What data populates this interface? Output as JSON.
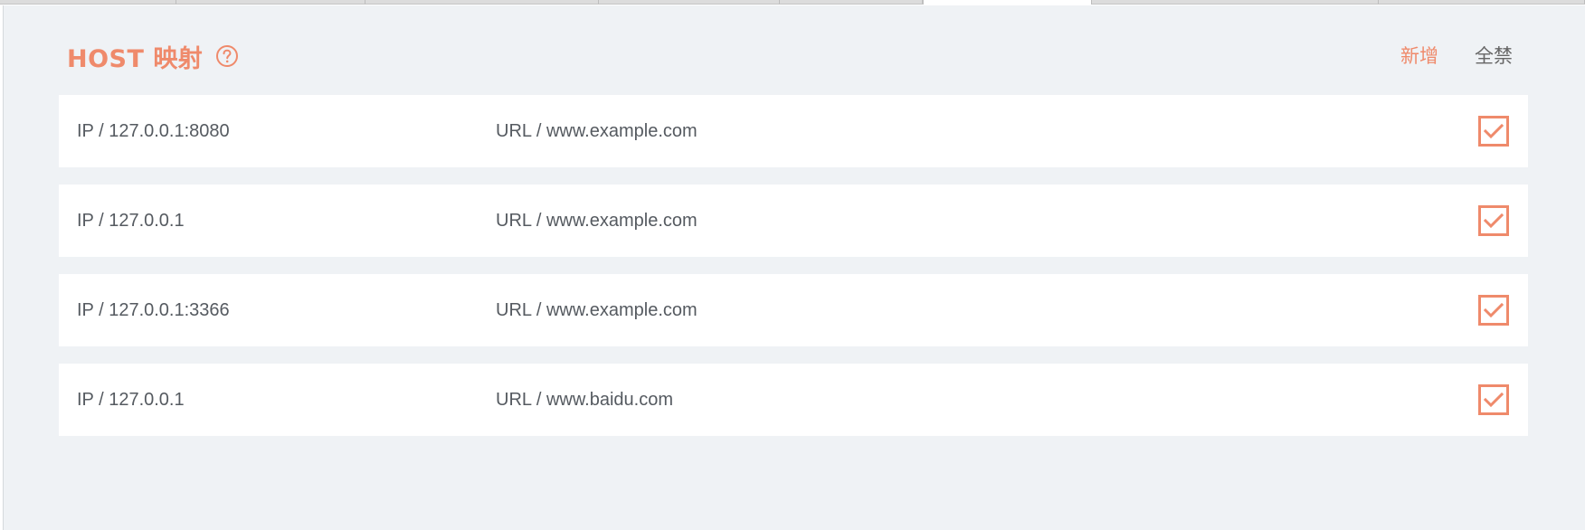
{
  "header": {
    "title": "HOST 映射",
    "help_icon": "question-circle-icon"
  },
  "actions": {
    "add_label": "新增",
    "disable_all_label": "全禁"
  },
  "colors": {
    "accent": "#ef8a6b",
    "panel_bg": "#eff2f5",
    "row_bg": "#ffffff",
    "text": "#555a60",
    "secondary_action": "#666666"
  },
  "mappings": [
    {
      "ip": "IP / 127.0.0.1:8080",
      "url": "URL / www.example.com",
      "enabled": true
    },
    {
      "ip": "IP / 127.0.0.1",
      "url": "URL / www.example.com",
      "enabled": true
    },
    {
      "ip": "IP / 127.0.0.1:3366",
      "url": "URL / www.example.com",
      "enabled": true
    },
    {
      "ip": "IP / 127.0.0.1",
      "url": "URL / www.baidu.com",
      "enabled": true
    }
  ]
}
